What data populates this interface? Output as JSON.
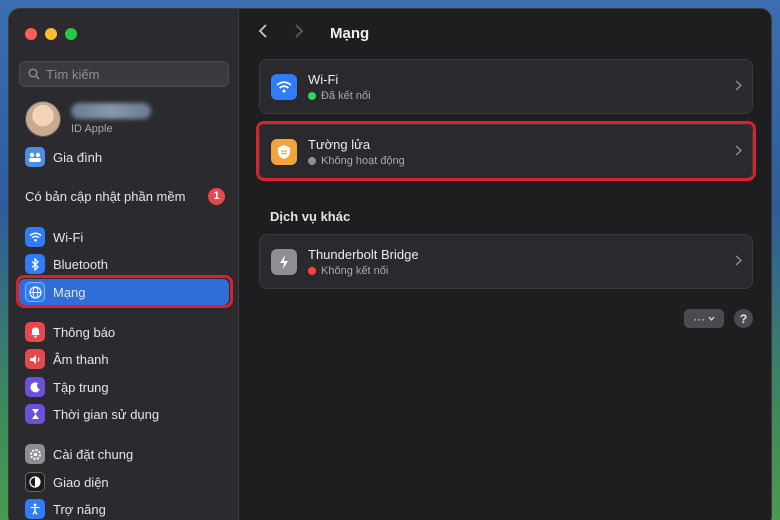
{
  "window": {
    "title": "Mạng",
    "nav": {
      "back_icon": "chevron-left-icon",
      "forward_icon": "chevron-right-icon"
    }
  },
  "sidebar": {
    "search": {
      "placeholder": "Tìm kiếm"
    },
    "profile": {
      "subtitle": "ID Apple"
    },
    "family": {
      "label": "Gia đình"
    },
    "update": {
      "label": "Có bản cập nhật phần mềm",
      "badge": "1"
    },
    "groups": [
      [
        {
          "label": "Wi-Fi",
          "icon": "wifi-icon",
          "color": "#2f7cf6"
        },
        {
          "label": "Bluetooth",
          "icon": "bluetooth-icon",
          "color": "#2f7cf6"
        },
        {
          "label": "Mạng",
          "icon": "globe-icon",
          "color": "#2f7cf6",
          "active": true
        }
      ],
      [
        {
          "label": "Thông báo",
          "icon": "bell-icon",
          "color": "#e5484d"
        },
        {
          "label": "Âm thanh",
          "icon": "speaker-icon",
          "color": "#e5484d"
        },
        {
          "label": "Tập trung",
          "icon": "moon-icon",
          "color": "#6e4fd8"
        },
        {
          "label": "Thời gian sử dụng",
          "icon": "hourglass-icon",
          "color": "#6e4fd8"
        }
      ],
      [
        {
          "label": "Cài đặt chung",
          "icon": "gear-icon",
          "color": "#8e8e93"
        },
        {
          "label": "Giao diện",
          "icon": "appearance-icon",
          "color": "#1c1c1e"
        },
        {
          "label": "Trợ năng",
          "icon": "accessibility-icon",
          "color": "#2f7cf6"
        }
      ]
    ]
  },
  "main": {
    "wifi": {
      "title": "Wi-Fi",
      "status": "Đã kết nối",
      "status_color": "#30d158"
    },
    "firewall": {
      "title": "Tường lửa",
      "status": "Không hoạt động",
      "status_color": "#8e8e93"
    },
    "other_section": "Dịch vụ khác",
    "thunderbolt": {
      "title": "Thunderbolt Bridge",
      "status": "Không kết nối",
      "status_color": "#ff453a"
    },
    "more_button": "···",
    "help_button": "?"
  },
  "colors": {
    "highlight": "#d8222c",
    "accent": "#2f6ed8"
  }
}
